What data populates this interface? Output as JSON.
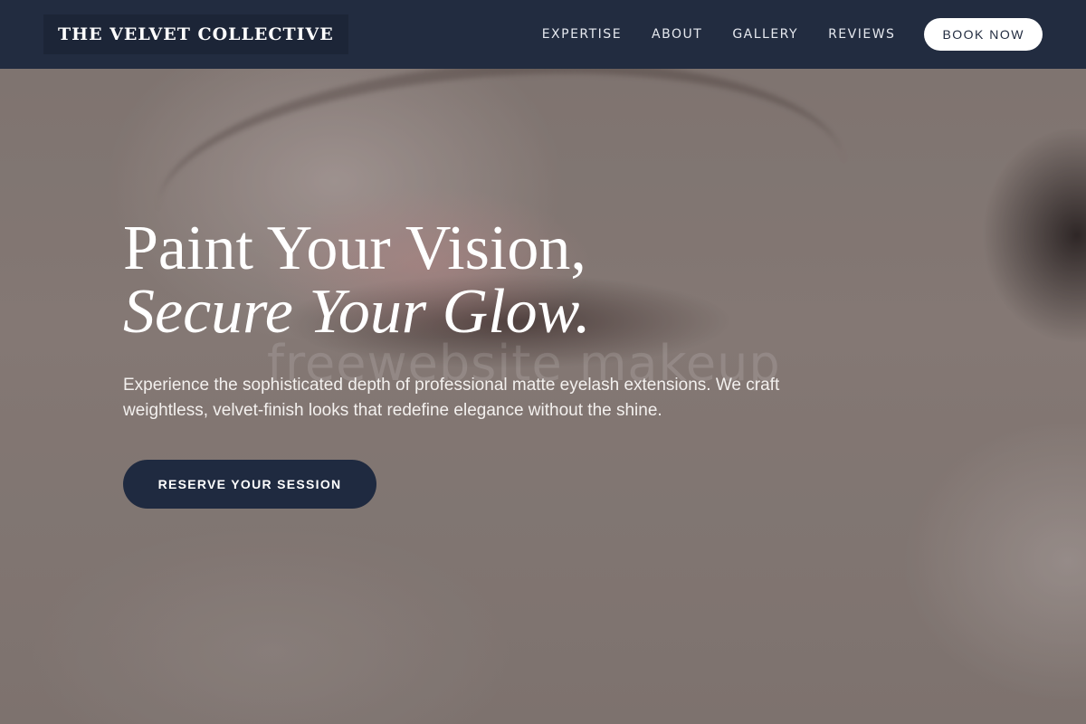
{
  "header": {
    "logo": "THE VELVET COLLECTIVE",
    "nav": [
      "EXPERTISE",
      "ABOUT",
      "GALLERY",
      "REVIEWS"
    ],
    "book_label": "BOOK NOW"
  },
  "hero": {
    "headline_line1": "Paint Your Vision,",
    "headline_line2": "Secure Your Glow.",
    "subtext": "Experience the sophisticated depth of professional matte eyelash extensions. We craft weightless, velvet-finish looks that redefine elegance without the shine.",
    "cta_label": "RESERVE YOUR SESSION",
    "watermark": "freewebsite makeup"
  },
  "colors": {
    "header_bg": "#222c40",
    "cta_bg": "#1f2a40",
    "book_bg": "#ffffff"
  }
}
